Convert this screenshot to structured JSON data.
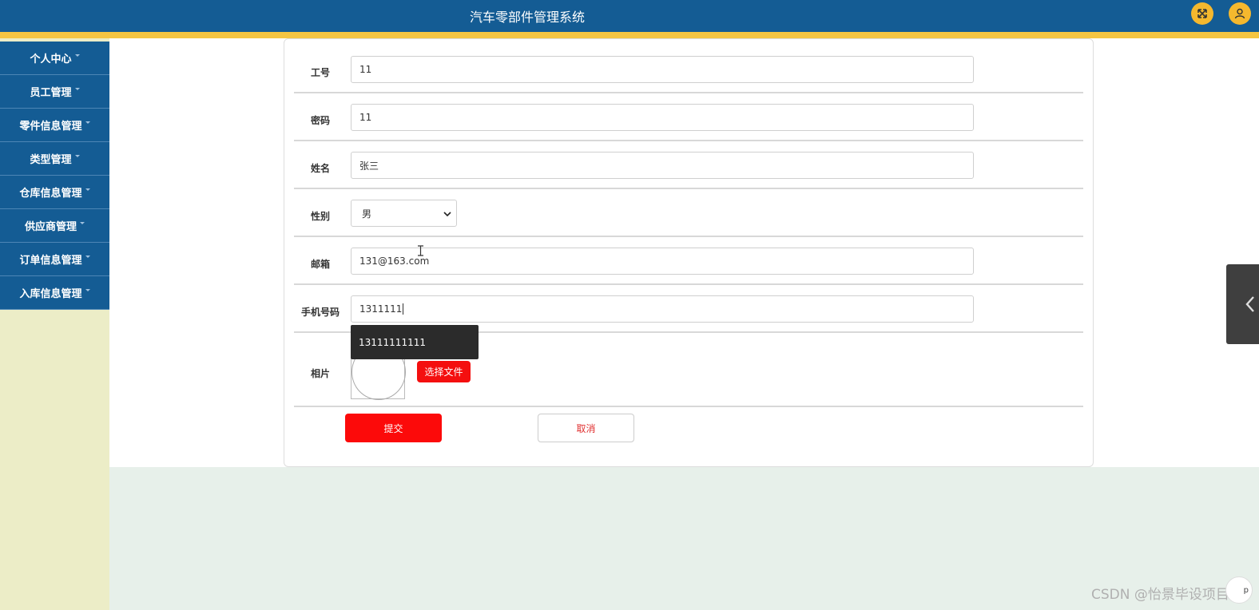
{
  "header": {
    "title": "汽车零部件管理系统",
    "fullscreen_icon": "expand-icon",
    "user_icon": "user-icon"
  },
  "sidebar": {
    "items": [
      {
        "label": "个人中心"
      },
      {
        "label": "员工管理"
      },
      {
        "label": "零件信息管理"
      },
      {
        "label": "类型管理"
      },
      {
        "label": "仓库信息管理"
      },
      {
        "label": "供应商管理"
      },
      {
        "label": "订单信息管理"
      },
      {
        "label": "入库信息管理"
      }
    ]
  },
  "form": {
    "employee_id": {
      "label": "工号",
      "value": "11"
    },
    "password": {
      "label": "密码",
      "value": "11"
    },
    "name": {
      "label": "姓名",
      "value": "张三"
    },
    "gender": {
      "label": "性别",
      "value": "男"
    },
    "email": {
      "label": "邮箱",
      "value": "131@163.com"
    },
    "phone": {
      "label": "手机号码",
      "value": "1311111"
    },
    "photo": {
      "label": "相片",
      "choose_file": "选择文件"
    },
    "submit": "提交",
    "cancel": "取消"
  },
  "autocomplete": {
    "suggestion": "13111111111"
  },
  "watermark": "CSDN @怡景毕设项目",
  "corner_button": "p",
  "colors": {
    "header": "#145c94",
    "stripe": "#f5c542",
    "accent_red": "#fc0a0a"
  }
}
